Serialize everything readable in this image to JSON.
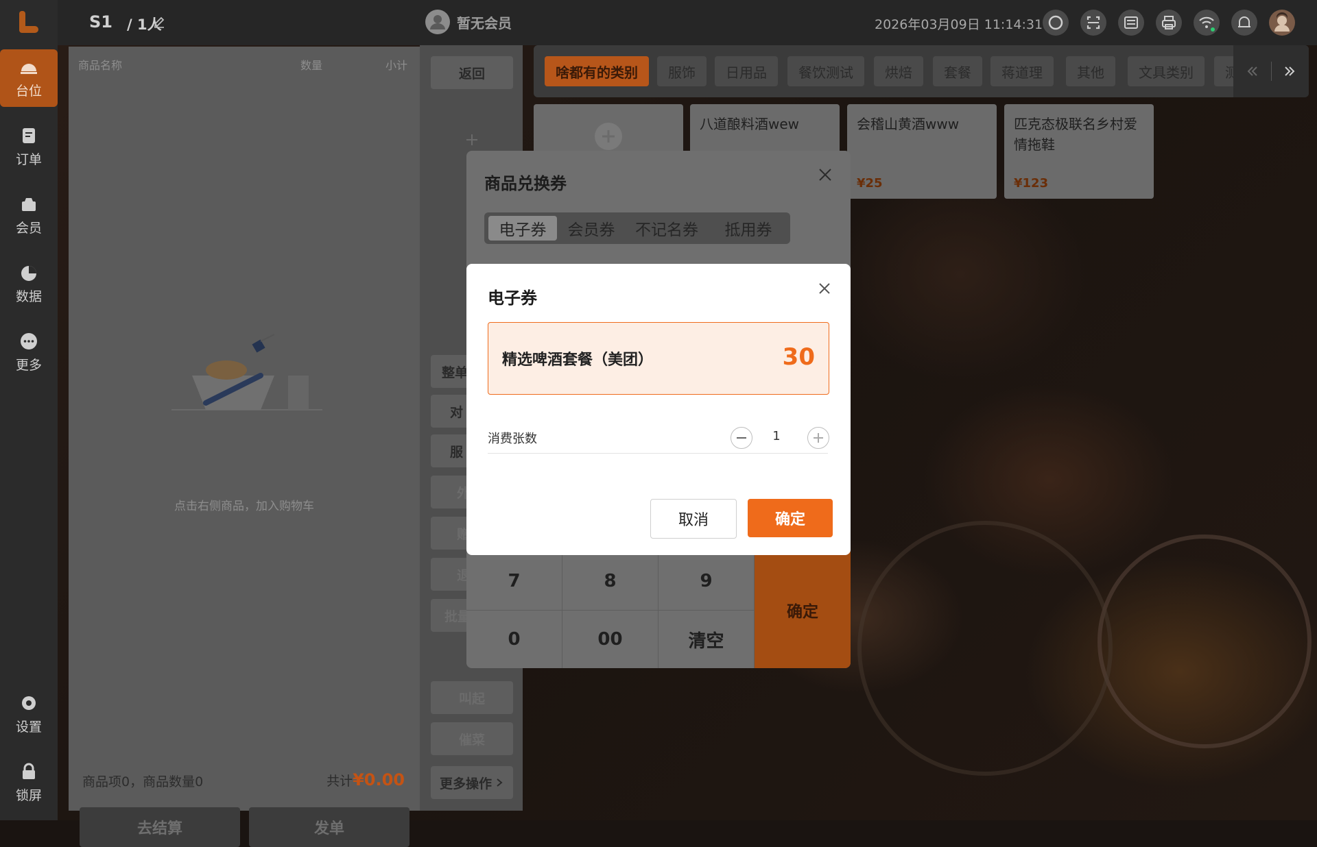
{
  "topbar": {
    "table_label": "S1",
    "people_label": "/ 1人",
    "member_label": "暂无会员",
    "datetime": "2026年03月09日 11:14:31"
  },
  "nav": {
    "items": [
      {
        "label": "台位"
      },
      {
        "label": "订单"
      },
      {
        "label": "会员"
      },
      {
        "label": "数据"
      },
      {
        "label": "更多"
      },
      {
        "label": "设置"
      },
      {
        "label": "锁屏"
      }
    ]
  },
  "cart": {
    "col_name": "商品名称",
    "col_qty": "数量",
    "col_subtotal": "小计",
    "empty_text": "点击右侧商品，加入购物车",
    "summary": "商品项0，商品数量0",
    "total_prefix": "共计",
    "total": "¥0.00",
    "checkout": "去结算",
    "send": "发单"
  },
  "actions": {
    "back": "返回",
    "items": [
      "整单",
      "对",
      "服",
      "外",
      "赠",
      "退",
      "批量",
      "叫起",
      "催菜"
    ],
    "more": "更多操作"
  },
  "categories": [
    "啥都有的类别",
    "服饰",
    "日用品",
    "餐饮测试",
    "烘焙",
    "套餐",
    "蒋道理",
    "其他",
    "文具类别",
    "测"
  ],
  "products": [
    {
      "name": "",
      "price": ""
    },
    {
      "name": "八道酿料酒wew",
      "price": ""
    },
    {
      "name": "会稽山黄酒www",
      "price": "¥25"
    },
    {
      "name": "匹克态极联名乡村爱情拖鞋",
      "price": "¥123"
    }
  ],
  "base_dialog": {
    "title": "商品兑换券",
    "tabs": [
      "电子券",
      "会员券",
      "不记名券",
      "抵用券"
    ],
    "keys": [
      "7",
      "8",
      "9",
      "0",
      "00",
      "清空"
    ],
    "confirm": "确定"
  },
  "dialog": {
    "title": "电子券",
    "voucher_name": "精选啤酒套餐（美团）",
    "voucher_value": "30",
    "qty_label": "消费张数",
    "qty_value": "1",
    "cancel": "取消",
    "ok": "确定"
  },
  "colors": {
    "accent": "#ef6b1b",
    "voucher_bg": "#fdeee4"
  }
}
